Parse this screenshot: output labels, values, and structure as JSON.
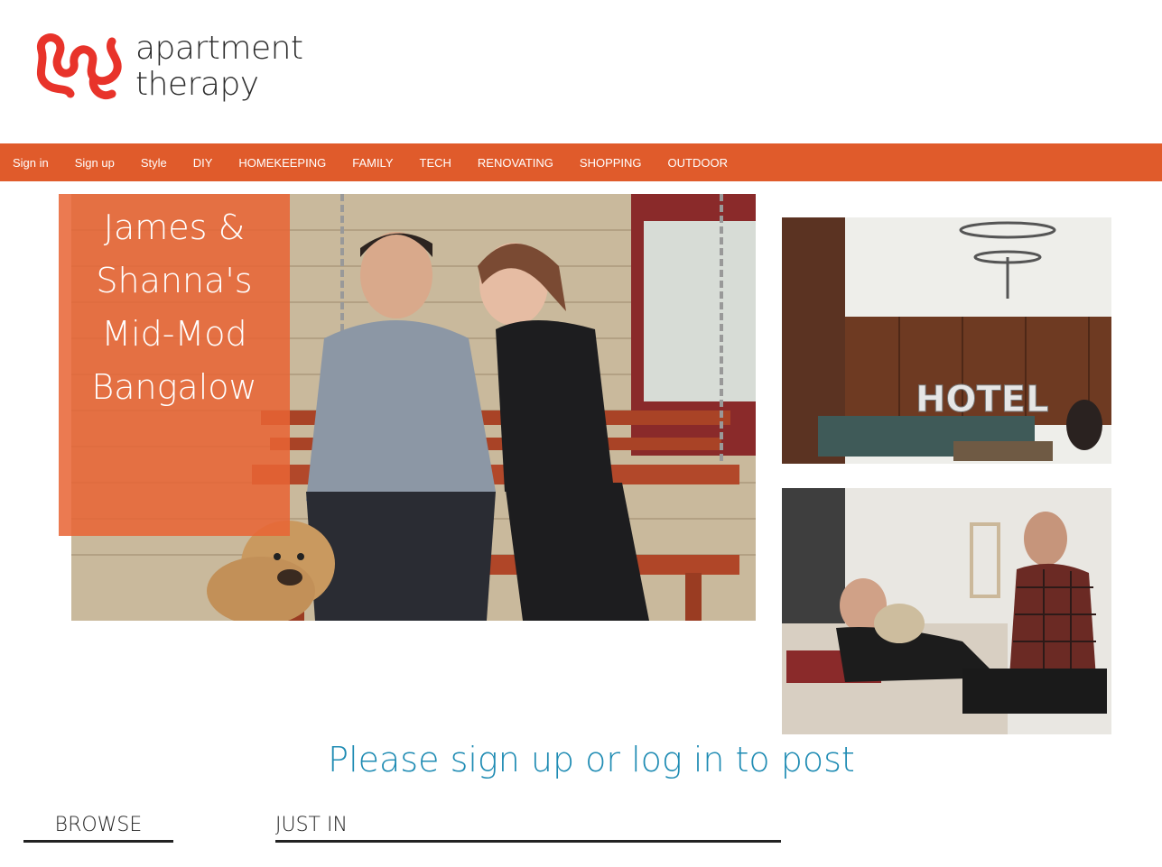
{
  "brand": {
    "line1": "apartment",
    "line2": "therapy",
    "accent_color": "#e05b2b",
    "logo_icon": "squiggle-logo-icon"
  },
  "nav": {
    "items": [
      {
        "label": "Sign in"
      },
      {
        "label": "Sign up"
      },
      {
        "label": "Style"
      },
      {
        "label": "DIY"
      },
      {
        "label": "HOMEKEEPING"
      },
      {
        "label": "FAMILY"
      },
      {
        "label": "TECH"
      },
      {
        "label": "RENOVATING"
      },
      {
        "label": "SHOPPING"
      },
      {
        "label": "OUTDOOR"
      }
    ]
  },
  "hero": {
    "caption_lines": [
      "James &",
      "Shanna's",
      "Mid-Mod",
      "Bangalow"
    ]
  },
  "thumbs": {
    "first_sign": "HOTEL"
  },
  "cta": {
    "text": "Please sign up or log in to post",
    "color": "#1e8bb3"
  },
  "sections": {
    "browse": "BROWSE",
    "just_in": "JUST IN"
  }
}
